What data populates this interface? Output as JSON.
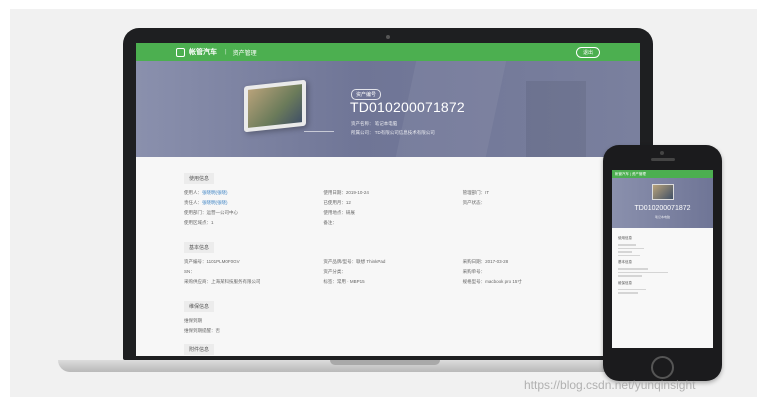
{
  "laptop": {
    "app": {
      "brand": "帐管汽车",
      "separator": "|",
      "nav_title": "资产管理",
      "header_button": "退出"
    },
    "hero": {
      "badge": "资产编号",
      "asset_id": "TD010200071872",
      "meta_line1": "资产名称：  笔记本电脑",
      "meta_line2": "所属公司：  TD有限公司信息技术有限公司"
    },
    "sections": [
      {
        "title": "使用信息",
        "fields": [
          {
            "label": "使用人：",
            "value": "张晓明(张晓)",
            "link": true
          },
          {
            "label": "使用日期：",
            "value": "2019-10-24",
            "link": false
          },
          {
            "label": "管理部门：",
            "value": "IT",
            "link": false
          },
          {
            "label": "责任人：",
            "value": "张晓明(张晓)",
            "link": true
          },
          {
            "label": "已使用月：",
            "value": "12",
            "link": false
          },
          {
            "label": "资产状态：",
            "value": "",
            "link": false
          },
          {
            "label": "使用部门：",
            "value": "运营一公司中心",
            "link": false
          },
          {
            "label": "使用地点：",
            "value": "研展",
            "link": false
          },
          {
            "label": "",
            "value": "",
            "link": false
          },
          {
            "label": "使用区域点：",
            "value": "1",
            "link": false
          },
          {
            "label": "备注：",
            "value": "",
            "link": false
          },
          {
            "label": "",
            "value": "",
            "link": false
          }
        ]
      },
      {
        "title": "基本信息",
        "fields": [
          {
            "label": "资产编号：",
            "value": "1101PLM0F0GV",
            "link": false
          },
          {
            "label": "资产品牌/型号：",
            "value": "联想 ThinkPad",
            "link": false
          },
          {
            "label": "采购日期：",
            "value": "2017-03-28",
            "link": false
          },
          {
            "label": "SN：",
            "value": "",
            "link": false
          },
          {
            "label": "资产分类：",
            "value": "",
            "link": false
          },
          {
            "label": "采购单号：",
            "value": "",
            "link": false
          },
          {
            "label": "采购供应商：",
            "value": "上海某科技服务有限公司",
            "link": false
          },
          {
            "label": "标签：",
            "value": "常用 · MBP15",
            "link": false
          },
          {
            "label": "规格型号：",
            "value": "macbook pro 15寸",
            "link": false
          }
        ]
      }
    ],
    "section3_title": "维保信息",
    "section3_rows": [
      "维保到期",
      "维保到期提醒：否"
    ],
    "section4_title": "附件信息"
  },
  "phone": {
    "header": "帐管汽车  |  资产管理",
    "asset_id": "TD010200071872",
    "meta": "笔记本电脑",
    "section_titles": [
      "使用信息",
      "基本信息",
      "维保信息"
    ]
  },
  "watermark": "https://blog.csdn.net/yunqinsight"
}
